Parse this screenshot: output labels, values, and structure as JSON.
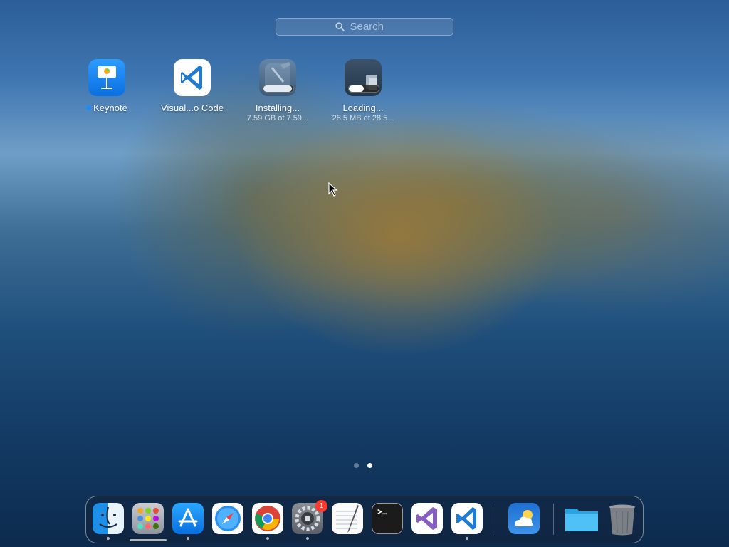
{
  "search": {
    "placeholder": "Search"
  },
  "apps": [
    {
      "name": "Keynote",
      "sub": "",
      "is_new": true
    },
    {
      "name": "Visual...o Code",
      "sub": ""
    },
    {
      "name": "Installing...",
      "sub": "7.59 GB of 7.59...",
      "progress": 0.99,
      "icon": "xcode-icon"
    },
    {
      "name": "Loading...",
      "sub": "28.5 MB of 28.5...",
      "progress": 0.5,
      "icon": "loading-app-icon"
    }
  ],
  "pager": {
    "pages": 2,
    "current": 2
  },
  "dock": {
    "items": [
      {
        "name": "finder-icon",
        "running": true
      },
      {
        "name": "launchpad-icon",
        "running": true
      },
      {
        "name": "app-store-icon",
        "running": true
      },
      {
        "name": "safari-icon",
        "running": false
      },
      {
        "name": "chrome-icon",
        "running": true
      },
      {
        "name": "system-preferences-icon",
        "running": true,
        "badge": "1"
      },
      {
        "name": "textedit-icon",
        "running": false
      },
      {
        "name": "terminal-icon",
        "running": false
      },
      {
        "name": "visual-studio-icon",
        "running": false
      },
      {
        "name": "vscode-icon",
        "running": true
      },
      {
        "name": "weather-icon",
        "running": false
      },
      {
        "name": "downloads-folder-icon",
        "running": false
      },
      {
        "name": "trash-icon",
        "running": false
      }
    ]
  },
  "colors": {
    "badge": "#ff3b30",
    "new_dot": "#1a8cff",
    "vscode_blue": "#1f7ad1"
  }
}
